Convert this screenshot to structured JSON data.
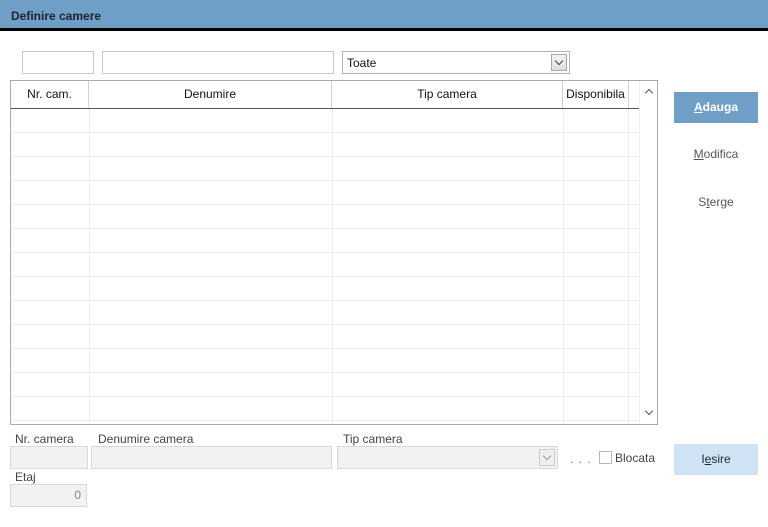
{
  "window": {
    "title": "Definire camere"
  },
  "filters": {
    "nr_value": "",
    "denumire_value": "",
    "tip_selected": "Toate"
  },
  "table": {
    "columns": [
      "Nr. cam.",
      "Denumire",
      "Tip camera",
      "Disponibila"
    ],
    "rows": []
  },
  "buttons": {
    "adauga": {
      "label": "Adauga",
      "mnemonic": "A"
    },
    "modifica": {
      "label": "Modifica",
      "mnemonic": "M"
    },
    "sterge": {
      "label": "Sterge",
      "mnemonic": "t"
    },
    "iesire": {
      "label": "Iesire",
      "mnemonic": "e"
    }
  },
  "form": {
    "nr_camera_label": "Nr. camera",
    "denumire_camera_label": "Denumire camera",
    "tip_camera_label": "Tip camera",
    "browse_dots": ". . .",
    "blocata_label": "Blocata",
    "blocata_checked": false,
    "etaj_label": "Etaj",
    "etaj_value": "0"
  },
  "colors": {
    "accent": "#6f9fc7",
    "exit_button": "#cfe3f4"
  },
  "icons": [
    "chevron-down-icon",
    "scroll-up-icon",
    "scroll-down-icon",
    "checkbox-icon"
  ]
}
